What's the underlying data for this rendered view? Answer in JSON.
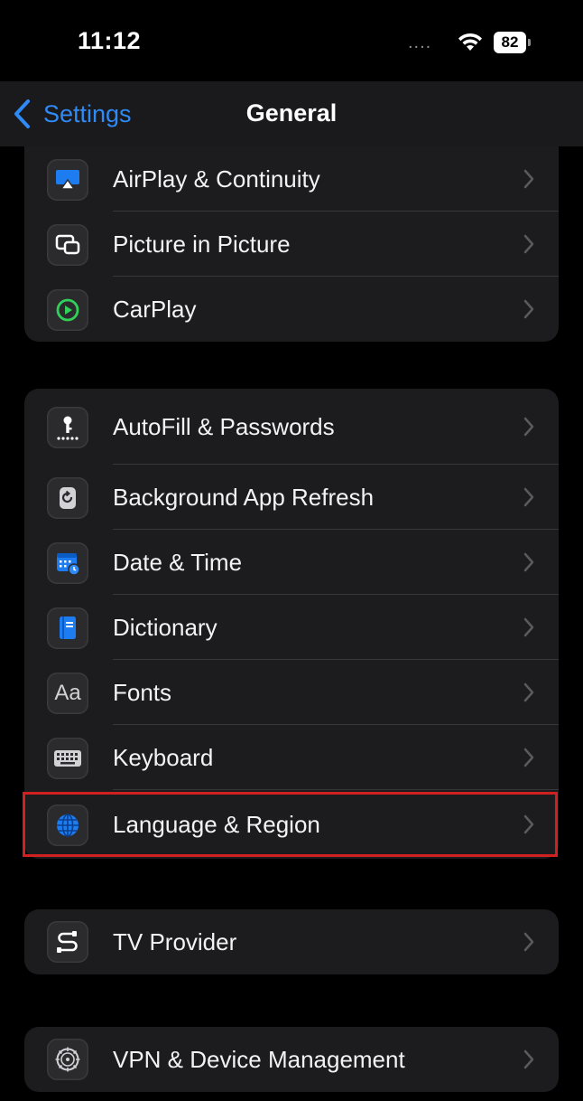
{
  "status": {
    "time": "11:12",
    "signal": "....",
    "battery": "82"
  },
  "nav": {
    "back_label": "Settings",
    "title": "General"
  },
  "groups": [
    {
      "items": [
        {
          "label": "AirPlay & Continuity"
        },
        {
          "label": "Picture in Picture"
        },
        {
          "label": "CarPlay"
        }
      ]
    },
    {
      "items": [
        {
          "label": "AutoFill & Passwords"
        },
        {
          "label": "Background App Refresh"
        },
        {
          "label": "Date & Time"
        },
        {
          "label": "Dictionary"
        },
        {
          "label": "Fonts",
          "icon_text": "Aa"
        },
        {
          "label": "Keyboard"
        },
        {
          "label": "Language & Region",
          "highlighted": true
        }
      ]
    },
    {
      "items": [
        {
          "label": "TV Provider"
        }
      ]
    },
    {
      "items": [
        {
          "label": "VPN & Device Management"
        }
      ]
    }
  ],
  "colors": {
    "accent": "#2f8af5",
    "highlight": "#d0201f",
    "carplay_green": "#30d158"
  }
}
